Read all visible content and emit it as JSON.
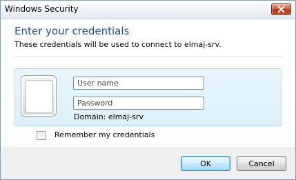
{
  "window": {
    "title": "Windows Security"
  },
  "icons": {
    "close": "close-icon",
    "user_tile": "user-tile-icon"
  },
  "dialog": {
    "heading": "Enter your credentials",
    "subtext": "These credentials will be used to connect to elmaj-srv."
  },
  "credentials": {
    "username_placeholder": "User name",
    "username_value": "",
    "password_placeholder": "Password",
    "password_value": "",
    "domain_text": "Domain: elmaj-srv"
  },
  "remember": {
    "label": "Remember my credentials",
    "checked": false
  },
  "buttons": {
    "ok_label": "OK",
    "cancel_label": "Cancel"
  },
  "colors": {
    "heading": "#1e4d9e",
    "tile_background": "#e8f6fd",
    "close_button": "#c94b2a",
    "footer_background": "#f0f0f0"
  }
}
